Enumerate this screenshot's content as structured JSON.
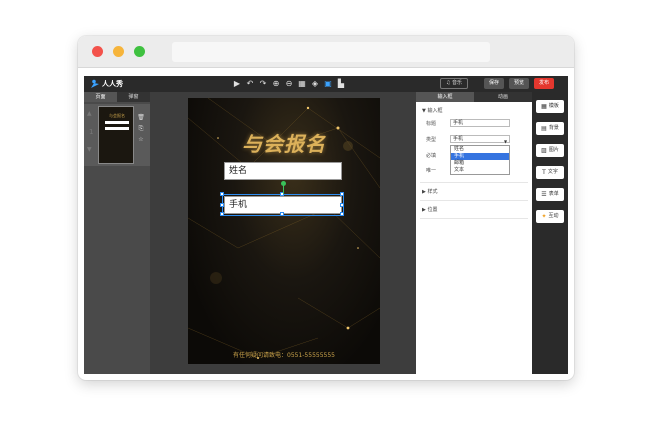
{
  "app": {
    "logo_text": "人人秀",
    "music_label": "♫ 音乐",
    "save_label": "保存",
    "preview_label": "预览",
    "publish_label": "发布"
  },
  "toolbar": {
    "tools": [
      {
        "icon": "pointer-icon",
        "glyph": "▶"
      },
      {
        "icon": "undo-icon",
        "glyph": "↶"
      },
      {
        "icon": "redo-icon",
        "glyph": "↷"
      },
      {
        "icon": "zoom-in-icon",
        "glyph": "⊕"
      },
      {
        "icon": "zoom-out-icon",
        "glyph": "⊖"
      },
      {
        "icon": "grid-icon",
        "glyph": "▦"
      },
      {
        "icon": "layers-icon",
        "glyph": "◈"
      },
      {
        "icon": "phone-icon",
        "glyph": "▣"
      },
      {
        "icon": "align-icon",
        "glyph": "▙"
      }
    ]
  },
  "left_panel": {
    "tabs": [
      "页面",
      "弹窗"
    ],
    "thumb_title": "与会报名"
  },
  "canvas": {
    "title": "与会报名",
    "field_name": "姓名",
    "field_phone": "手机",
    "footer": "有任何疑问请致电：0551-55555555"
  },
  "props": {
    "tabs": [
      "输入框",
      "动画"
    ],
    "section_input": "输入框",
    "label_title": "标题",
    "title_value": "手机",
    "label_type": "类型",
    "type_value": "手机",
    "label_required": "必填",
    "label_unique": "唯一",
    "type_options": [
      "姓名",
      "手机",
      "邮箱",
      "文本"
    ],
    "type_selected_index": 1,
    "section_style": "样式",
    "section_position": "位置"
  },
  "right_bar": {
    "items": [
      {
        "label": "模板",
        "icon": "template-icon",
        "glyph": "▦"
      },
      {
        "label": "背景",
        "icon": "background-icon",
        "glyph": "▤"
      },
      {
        "label": "图片",
        "icon": "image-icon",
        "glyph": "▨"
      },
      {
        "label": "文字",
        "icon": "text-icon",
        "glyph": "T"
      },
      {
        "label": "表单",
        "icon": "form-icon",
        "glyph": "☰"
      },
      {
        "label": "互动",
        "icon": "interaction-icon",
        "glyph": "✦"
      }
    ]
  }
}
